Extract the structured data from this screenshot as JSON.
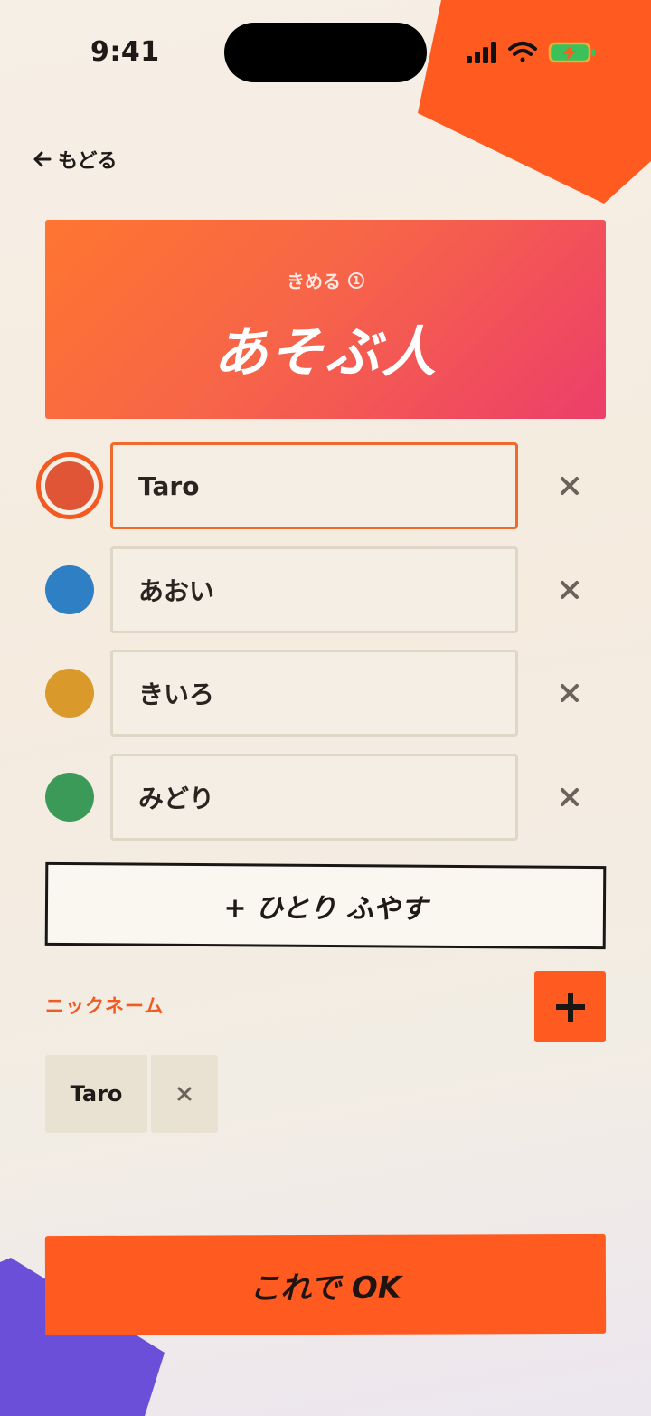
{
  "status_bar": {
    "time": "9:41"
  },
  "nav": {
    "back_label": "もどる"
  },
  "hero": {
    "subtitle": "きめる",
    "step": "1",
    "title": "あそぶ人"
  },
  "players": [
    {
      "name": "Taro",
      "color": "#e05536",
      "selected": true
    },
    {
      "name": "あおい",
      "color": "#2f7fc5",
      "selected": false
    },
    {
      "name": "きいろ",
      "color": "#d99a2b",
      "selected": false
    },
    {
      "name": "みどり",
      "color": "#3c9a58",
      "selected": false
    }
  ],
  "add_player_label": "+ ひとり ふやす",
  "nickname": {
    "label": "ニックネーム",
    "chips": [
      "Taro"
    ]
  },
  "confirm_label": "これで OK",
  "colors": {
    "accent": "#ff5a1f",
    "deco_purple": "#6b4fd8"
  }
}
